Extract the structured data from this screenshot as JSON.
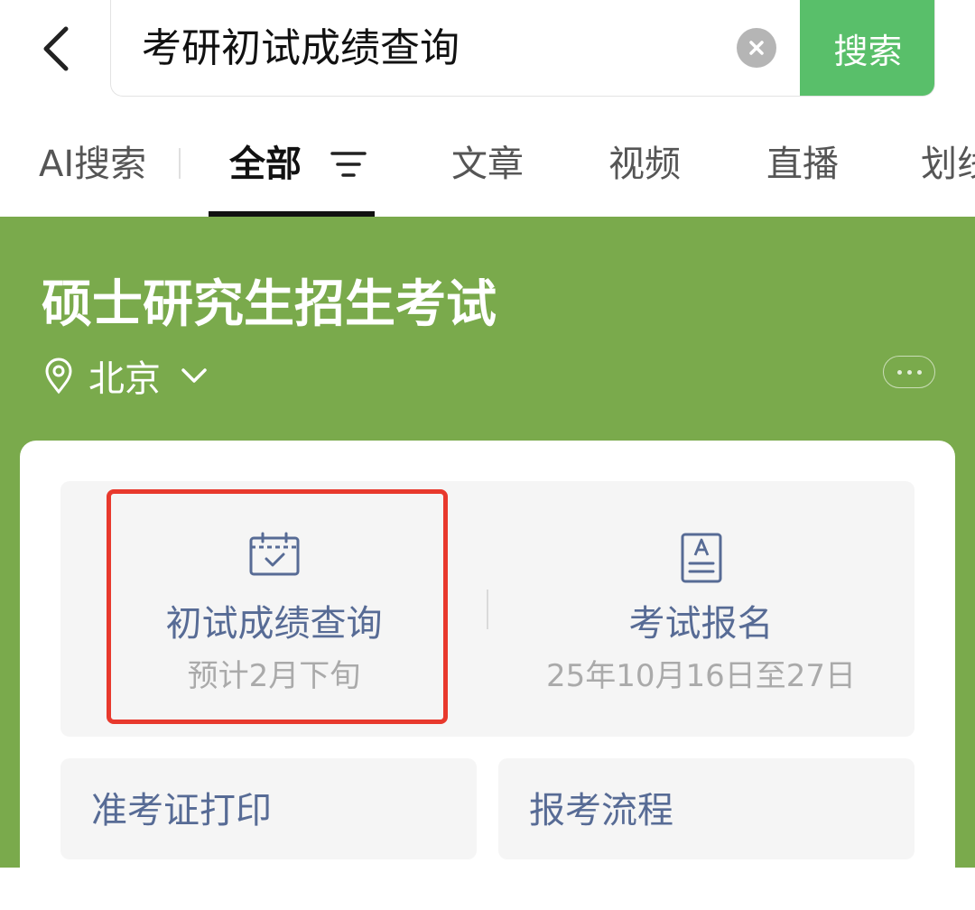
{
  "search": {
    "query": "考研初试成绩查询",
    "button_label": "搜索"
  },
  "tabs": [
    {
      "label": "AI搜索"
    },
    {
      "label": "全部"
    },
    {
      "label": "文章"
    },
    {
      "label": "视频"
    },
    {
      "label": "直播"
    },
    {
      "label": "划线"
    }
  ],
  "entity": {
    "title": "硕士研究生招生考试",
    "location": "北京"
  },
  "services": [
    {
      "name": "初试成绩查询",
      "subtitle": "预计2月下旬",
      "icon": "calendar-check-icon"
    },
    {
      "name": "考试报名",
      "subtitle": "25年10月16日至27日",
      "icon": "document-a-icon"
    }
  ],
  "links": [
    {
      "label": "准考证打印"
    },
    {
      "label": "报考流程"
    }
  ],
  "colors": {
    "accent_green": "#59bf6a",
    "card_background_green": "#7aaa4c",
    "link_blue": "#576b95",
    "highlight_red": "#e8392d"
  }
}
